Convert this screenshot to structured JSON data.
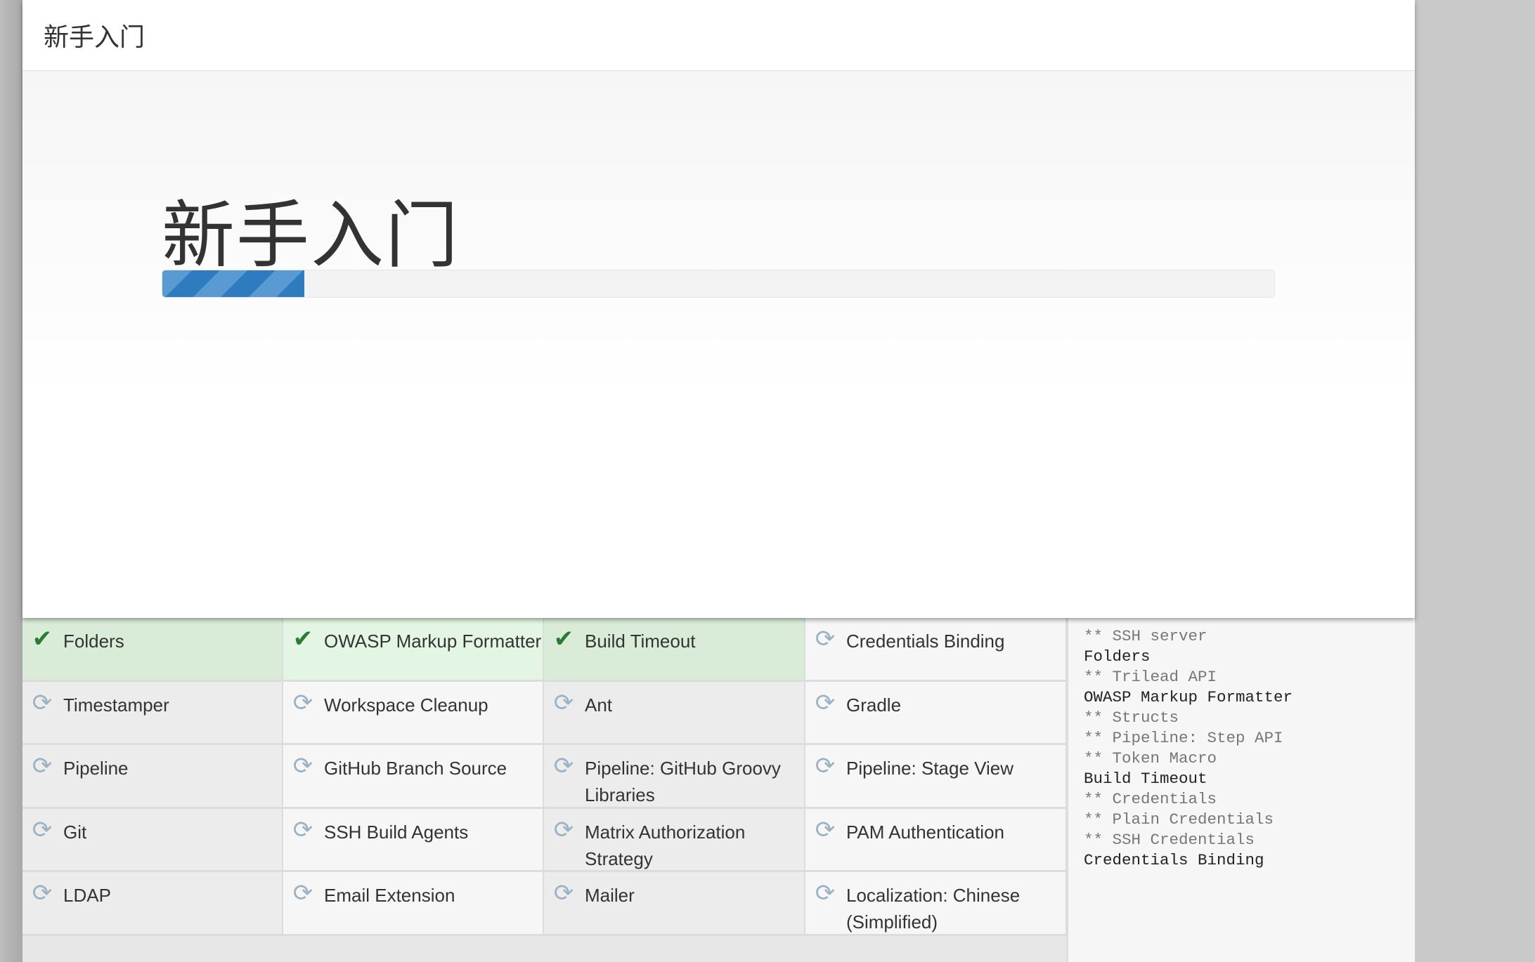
{
  "header": {
    "title": "新手入门"
  },
  "main": {
    "title": "新手入门",
    "progress_percent": 12.8,
    "progress_color": "#2f7bbf"
  },
  "plugins": [
    {
      "name": "Folders",
      "status": "installed",
      "icon": "check-icon"
    },
    {
      "name": "OWASP Markup Formatter",
      "status": "installed",
      "icon": "check-icon"
    },
    {
      "name": "Build Timeout",
      "status": "installed",
      "icon": "check-icon"
    },
    {
      "name": "Credentials Binding",
      "status": "pending",
      "icon": "refresh-icon"
    },
    {
      "name": "Timestamper",
      "status": "pending",
      "icon": "refresh-icon"
    },
    {
      "name": "Workspace Cleanup",
      "status": "pending",
      "icon": "refresh-icon"
    },
    {
      "name": "Ant",
      "status": "pending",
      "icon": "refresh-icon"
    },
    {
      "name": "Gradle",
      "status": "pending",
      "icon": "refresh-icon"
    },
    {
      "name": "Pipeline",
      "status": "pending",
      "icon": "refresh-icon"
    },
    {
      "name": "GitHub Branch Source",
      "status": "pending",
      "icon": "refresh-icon"
    },
    {
      "name": "Pipeline: GitHub Groovy Libraries",
      "status": "pending",
      "icon": "refresh-icon"
    },
    {
      "name": "Pipeline: Stage View",
      "status": "pending",
      "icon": "refresh-icon"
    },
    {
      "name": "Git",
      "status": "pending",
      "icon": "refresh-icon"
    },
    {
      "name": "SSH Build Agents",
      "status": "pending",
      "icon": "refresh-icon"
    },
    {
      "name": "Matrix Authorization Strategy",
      "status": "pending",
      "icon": "refresh-icon"
    },
    {
      "name": "PAM Authentication",
      "status": "pending",
      "icon": "refresh-icon"
    },
    {
      "name": "LDAP",
      "status": "pending",
      "icon": "refresh-icon"
    },
    {
      "name": "Email Extension",
      "status": "pending",
      "icon": "refresh-icon"
    },
    {
      "name": "Mailer",
      "status": "pending",
      "icon": "refresh-icon"
    },
    {
      "name": "Localization: Chinese (Simplified)",
      "status": "pending",
      "icon": "refresh-icon"
    }
  ],
  "log": [
    {
      "text": "** SSH server",
      "dependency": true
    },
    {
      "text": "Folders",
      "dependency": false
    },
    {
      "text": "** Trilead API",
      "dependency": true
    },
    {
      "text": "OWASP Markup Formatter",
      "dependency": false
    },
    {
      "text": "** Structs",
      "dependency": true
    },
    {
      "text": "** Pipeline: Step API",
      "dependency": true
    },
    {
      "text": "** Token Macro",
      "dependency": true
    },
    {
      "text": "Build Timeout",
      "dependency": false
    },
    {
      "text": "** Credentials",
      "dependency": true
    },
    {
      "text": "** Plain Credentials",
      "dependency": true
    },
    {
      "text": "** SSH Credentials",
      "dependency": true
    },
    {
      "text": "Credentials Binding",
      "dependency": false
    }
  ]
}
